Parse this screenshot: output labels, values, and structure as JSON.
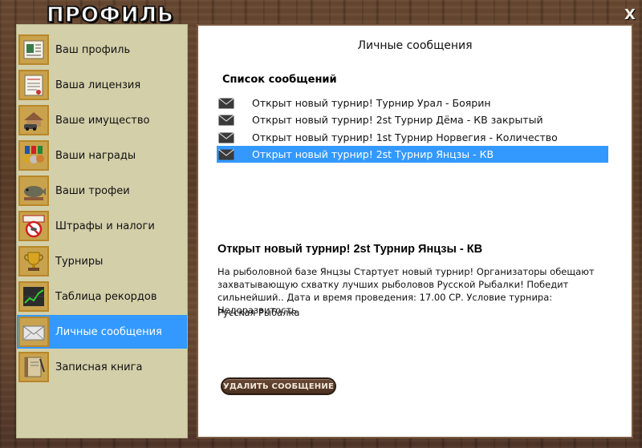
{
  "window": {
    "title": "ПРОФИЛЬ",
    "close_label": "X"
  },
  "sidebar": {
    "items": [
      {
        "label": "Ваш профиль",
        "icon": "profile-icon"
      },
      {
        "label": "Ваша лицензия",
        "icon": "license-icon"
      },
      {
        "label": "Ваше имущество",
        "icon": "property-icon"
      },
      {
        "label": "Ваши награды",
        "icon": "awards-icon"
      },
      {
        "label": "Ваши трофеи",
        "icon": "trophies-icon"
      },
      {
        "label": "Штрафы и налоги",
        "icon": "fines-icon"
      },
      {
        "label": "Турниры",
        "icon": "tournaments-icon"
      },
      {
        "label": "Таблица рекордов",
        "icon": "records-icon"
      },
      {
        "label": "Личные сообщения",
        "icon": "messages-icon",
        "active": true
      },
      {
        "label": "Записная книга",
        "icon": "notebook-icon"
      }
    ]
  },
  "main": {
    "title": "Личные сообщения",
    "list_heading": "Список сообщений",
    "messages": [
      {
        "subject": "Открыт новый турнир! Турнир Урал - Боярин"
      },
      {
        "subject": "Открыт новый турнир! 2st Турнир Дёма - КВ закрытый"
      },
      {
        "subject": "Открыт новый турнир! 1st Турнир Норвегия - Количество"
      },
      {
        "subject": "Открыт новый турнир! 2st Турнир Янцзы - КВ",
        "selected": true
      }
    ],
    "detail": {
      "title": "Открыт новый турнир! 2st Турнир Янцзы - КВ",
      "body": "На рыболовной базе Янцзы Стартует новый турнир! Организаторы обещают захватывающую схватку лучших рыболовов Русской Рыбалки! Победит сильнейший.. Дата и время проведения: 17.00 СР. Условие турнира: Недоразвитость",
      "signature": "Русская Рыбалка"
    },
    "delete_button_label": "УДАЛИТЬ СООБЩЕНИЕ"
  },
  "colors": {
    "selection": "#3399ff",
    "sidebar_bg": "#d3cfa9",
    "icon_border": "#b8862a"
  }
}
